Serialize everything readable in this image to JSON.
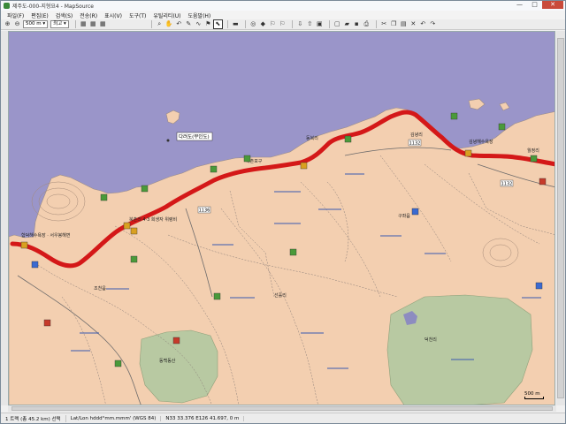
{
  "window": {
    "title": "제주도-000-지형요4 - MapSource",
    "controls": [
      "—",
      "□",
      "✕"
    ]
  },
  "menu": [
    "파일(F)",
    "편집(E)",
    "검색(S)",
    "전송(R)",
    "표시(V)",
    "도구(T)",
    "유틸리티(U)",
    "도움말(H)"
  ],
  "toolbar": {
    "zoom_value": "500 m",
    "detail_value": "최고"
  },
  "map": {
    "island_label": "다려도(무인도)",
    "labels": [
      "함덕해수욕장 · 서우봉해변",
      "북촌리 4·3 희생자 위령비",
      "북촌포구",
      "동복리",
      "김녕리",
      "김녕해수욕장",
      "월정리",
      "1132",
      "1132",
      "1136",
      "조천읍",
      "구좌읍",
      "선흘리",
      "덕천리",
      "동백동산"
    ],
    "scale_label": "500 m"
  },
  "status": {
    "route": "1 트랙 (총 45.2 km) 선택",
    "format": "Lat/Lon hddd°mm.mmm' (WGS 84)",
    "coords": "N33 33.376 E126 41.697, 0 m"
  }
}
